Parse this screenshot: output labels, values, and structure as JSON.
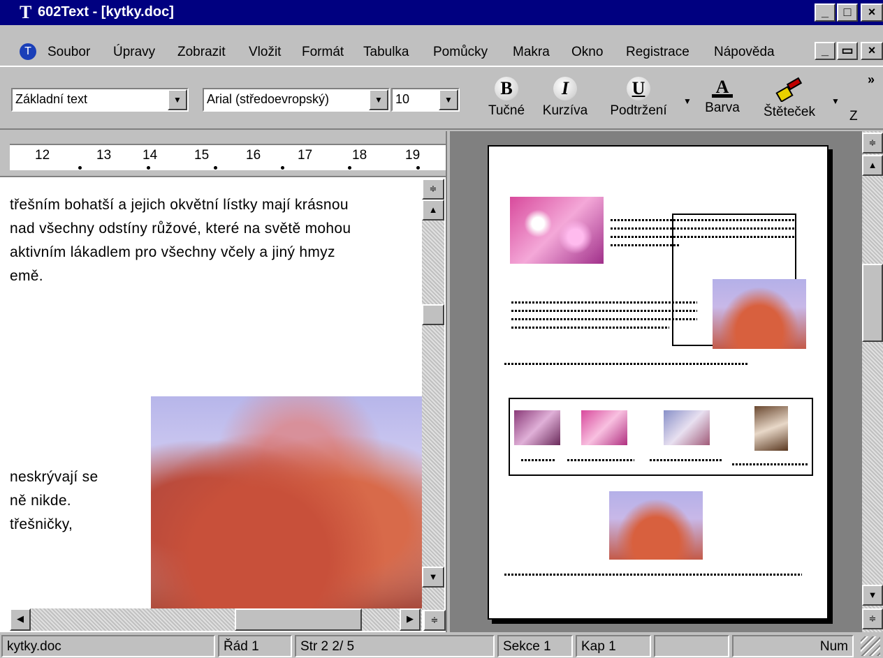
{
  "window": {
    "title": "602Text - [kytky.doc]",
    "app_icon": "T",
    "buttons": [
      "_",
      "□",
      "×"
    ]
  },
  "menubar": {
    "doc_icon": "T",
    "items": [
      "Soubor",
      "Úpravy",
      "Zobrazit",
      "Vložit",
      "Formát",
      "Tabulka",
      "Pomůcky",
      "Makra",
      "Okno",
      "Registrace",
      "Nápověda"
    ],
    "mdi_buttons": [
      "_",
      "▭",
      "×"
    ]
  },
  "toolbar": {
    "style_value": "Základní text",
    "font_value": "Arial (středoevropský)",
    "size_value": "10",
    "bold": {
      "glyph": "B",
      "label": "Tučné"
    },
    "italic": {
      "glyph": "I",
      "label": "Kurzíva"
    },
    "underline": {
      "glyph": "U",
      "label": "Podtržení"
    },
    "color": {
      "glyph": "A",
      "label": "Barva"
    },
    "brush": {
      "label": "Štěteček"
    },
    "more": {
      "label": "Z",
      "chevron": "»"
    }
  },
  "ruler": {
    "numbers": [
      "12",
      "13",
      "14",
      "15",
      "16",
      "17",
      "18",
      "19"
    ]
  },
  "document": {
    "lines_top": [
      "třešním bohatší a jejich okvětní lístky mají krásnou",
      "nad všechny odstíny růžové,  které na světě mohou",
      "aktivním  lákadlem pro všechny včely a jiný hmyz",
      "emě."
    ],
    "lines_bottom": [
      "neskrývají  se",
      "ně nikde.",
      "třešničky,"
    ]
  },
  "statusbar": {
    "file": "kytky.doc",
    "row": "Řád  1",
    "page": "Str   2    2/  5",
    "section": "Sekce 1",
    "chapter": "Kap  1",
    "mode": "Num"
  }
}
